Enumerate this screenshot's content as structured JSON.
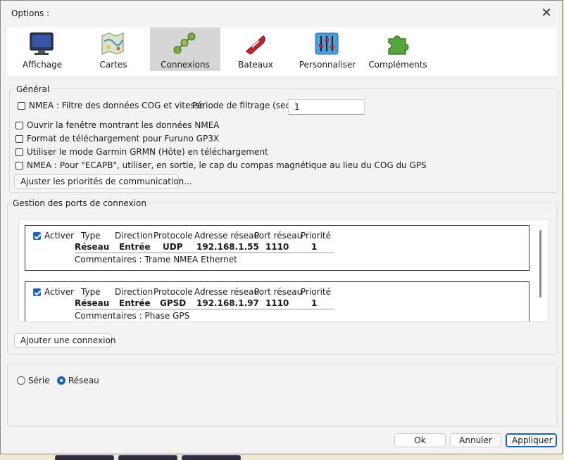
{
  "window": {
    "title": "Options :"
  },
  "toolbar": {
    "items": [
      {
        "label": "Affichage",
        "icon": "monitor-icon"
      },
      {
        "label": "Cartes",
        "icon": "chart-map-icon"
      },
      {
        "label": "Connexions",
        "icon": "connections-icon",
        "active": true
      },
      {
        "label": "Bateaux",
        "icon": "boat-icon"
      },
      {
        "label": "Personnaliser",
        "icon": "sliders-icon"
      },
      {
        "label": "Compléments",
        "icon": "puzzle-icon"
      }
    ]
  },
  "general": {
    "title": "Général",
    "nmea_filter_label": "NMEA : Filtre des données COG et vitesse",
    "period_label": "Période de filtrage (sec.)",
    "period_value": "1",
    "open_nmea_window": "Ouvrir la fenêtre montrant les données NMEA",
    "furuno_format": "Format de téléchargement pour Furuno GP3X",
    "garmin_mode": "Utiliser le mode Garmin GRMN (Hôte) en téléchargement",
    "ecapb": "NMEA : Pour \"ECAPB\", utiliser, en sortie, le cap du compas magnétique  au lieu du COG du GPS",
    "priorities_button": "Ajuster les priorités de communication..."
  },
  "ports": {
    "title": "Gestion des ports de connexion",
    "headers": {
      "enable": "Activer",
      "type": "Type",
      "direction": "Direction",
      "protocol": "Protocole",
      "address": "Adresse réseau",
      "port": "Port réseau",
      "priority": "Priorité"
    },
    "connections": [
      {
        "enabled": true,
        "type": "Réseau",
        "direction": "Entrée",
        "protocol": "UDP",
        "address": "192.168.1.55",
        "port": "1110",
        "priority": "1",
        "comment": "Commentaires : Trame NMEA Ethernet"
      },
      {
        "enabled": true,
        "type": "Réseau",
        "direction": "Entrée",
        "protocol": "GPSD",
        "address": "192.168.1.97",
        "port": "1110",
        "priority": "1",
        "comment": "Commentaires : Phase GPS"
      }
    ],
    "add_button": "Ajouter une connexion"
  },
  "mode": {
    "serial": "Série",
    "network": "Réseau",
    "selected": "network"
  },
  "footer": {
    "ok": "Ok",
    "cancel": "Annuler",
    "apply": "Appliquer"
  },
  "colors": {
    "accent": "#1665c1"
  }
}
